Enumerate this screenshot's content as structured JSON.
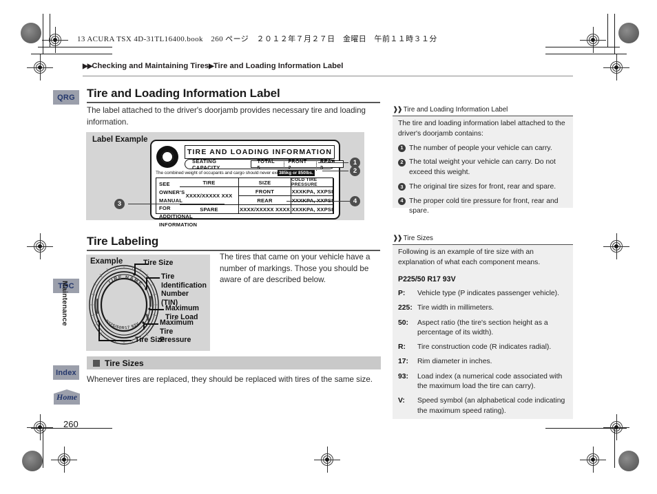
{
  "print_header": {
    "book_line": "13 ACURA TSX 4D-31TL16400.book　260 ページ　２０１２年７月２７日　金曜日　午前１１時３１分"
  },
  "breadcrumb": {
    "arrow1": "▶▶",
    "crumb1": "Checking and Maintaining Tires",
    "arrow2": "▶",
    "crumb2": "Tire and Loading Information Label"
  },
  "rail": {
    "qrg": "QRG",
    "toc": "TOC",
    "section": "Maintenance",
    "index": "Index",
    "home": "Home"
  },
  "main": {
    "h1": "Tire and Loading Information Label",
    "intro": "The label attached to the driver's doorjamb provides necessary tire and loading information.",
    "fig1_title": "Label Example",
    "h2": "Tire Labeling",
    "fig2_title": "Example",
    "labeling_body": "The tires that came on your vehicle have a number of markings. Those you should be aware of are described below.",
    "subsection_title": "Tire Sizes",
    "subsection_body": "Whenever tires are replaced, they should be replaced with tires of the same size.",
    "page_number": "260"
  },
  "label_art": {
    "icon": "tire-wheel-icon",
    "title": "TIRE AND LOADING INFORMATION",
    "seating_capacity_label": "SEATING CAPACITY",
    "seat_total": "TOTAL  5",
    "seat_front": "FRONT 2",
    "seat_rear": "REAR  3",
    "combined_text": "The combined weight of occupants and cargo should never  exceed",
    "weight_value": "385kg or 850lbs.",
    "table": {
      "headers": [
        "TIRE",
        "SIZE",
        "COLD TIRE PRESSURE"
      ],
      "rows": [
        {
          "tire": "FRONT",
          "size": "XXXX/XXXXX  XXX",
          "pressure": "XXXKPA, XXPSI"
        },
        {
          "tire": "REAR",
          "size": "XXXX/XXXXX  XXX",
          "pressure": "XXXKPA, XXPSI"
        },
        {
          "tire": "SPARE",
          "size": "XXXX/XXXXX  XXXX",
          "pressure": "XXXKPA, XXPSI"
        }
      ],
      "note": "SEE OWNER'S MANUAL FOR ADDITIONAL INFORMATION"
    },
    "callouts": [
      "1",
      "2",
      "3",
      "4"
    ]
  },
  "tire_art": {
    "label_tire_size_top": "Tire Size",
    "label_tin": "Tire Identification Number (TIN)",
    "label_max_load": "Maximum Tire Load",
    "label_max_pressure": "Maximum Tire Pressure",
    "label_tire_size_bottom": "Tire Size",
    "sidewall_top": "TIRE NAME",
    "sidewall_bottom": "P225/50R17 93V"
  },
  "sidebar": {
    "panel1": {
      "heading": "Tire and Loading Information Label",
      "intro": "The tire and loading information label attached to the driver's doorjamb contains:",
      "items": [
        {
          "num": "1",
          "text": "The number of people your vehicle can carry."
        },
        {
          "num": "2",
          "text": "The total weight your vehicle can carry. Do not exceed this weight."
        },
        {
          "num": "3",
          "text": "The original tire sizes for front, rear and spare."
        },
        {
          "num": "4",
          "text": "The proper cold tire pressure for front, rear and spare."
        }
      ]
    },
    "panel2": {
      "heading": "Tire Sizes",
      "intro": "Following is an example of tire size with an explanation of what each component means.",
      "code": "P225/50 R17 93V",
      "components": [
        {
          "key": "P:",
          "value": "Vehicle type (P indicates passenger vehicle)."
        },
        {
          "key": "225:",
          "value": "Tire width in millimeters."
        },
        {
          "key": "50:",
          "value": "Aspect ratio (the tire's section height as a percentage of its width)."
        },
        {
          "key": "R:",
          "value": "Tire construction code (R indicates radial)."
        },
        {
          "key": "17:",
          "value": "Rim diameter in inches."
        },
        {
          "key": "93:",
          "value": "Load index (a numerical code associated with the maximum load the tire can carry)."
        },
        {
          "key": "V:",
          "value": "Speed symbol (an alphabetical code indicating the maximum speed rating)."
        }
      ]
    }
  },
  "colors": {
    "rail_button": "#9b9fab",
    "rail_text": "#23366b",
    "figure_bg": "#d5d5d5",
    "sidebar_bg": "#efefef",
    "subbar_bg": "#c9c9c9",
    "callout": "#4d4d4d"
  }
}
